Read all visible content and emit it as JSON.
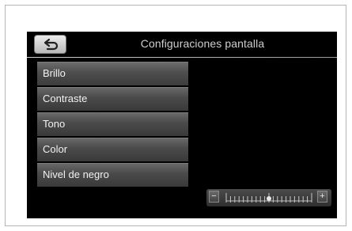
{
  "header": {
    "title": "Configuraciones pantalla",
    "back_icon": "back-arrow-icon"
  },
  "menu": {
    "items": [
      {
        "label": "Brillo"
      },
      {
        "label": "Contraste"
      },
      {
        "label": "Tono"
      },
      {
        "label": "Color"
      },
      {
        "label": "Nivel de negro"
      }
    ]
  },
  "slider": {
    "minus_label": "−",
    "plus_label": "+",
    "value_fraction": 0.5,
    "tick_count": 21
  },
  "colors": {
    "screen_bg": "#000000",
    "menu_item": "#4a4a4a",
    "text": "#f2f2f2",
    "title": "#cfcfcf"
  }
}
